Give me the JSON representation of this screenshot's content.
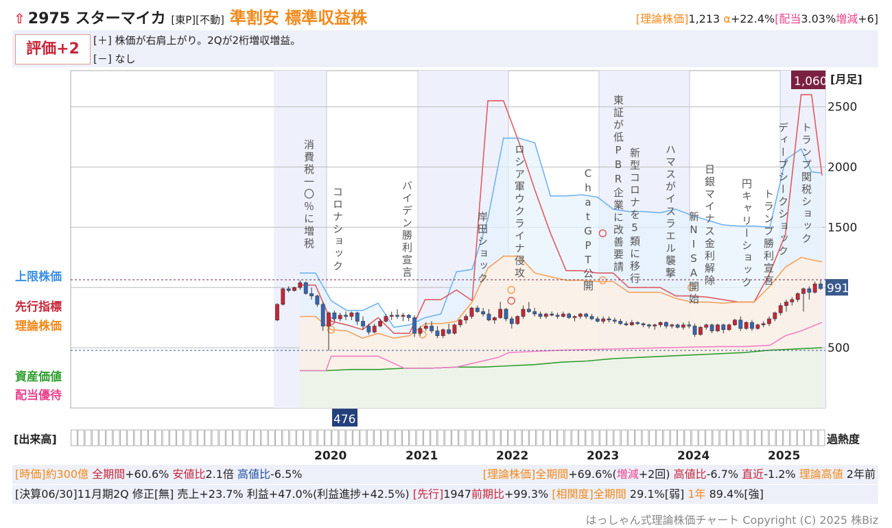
{
  "header": {
    "code": "2975",
    "name": "スターマイカ",
    "market": "[東P][不動]",
    "tags": "準割安 標準収益株",
    "theory_label": "[理論株価]",
    "theory_value": "1,213",
    "alpha_label": "α",
    "alpha_value": "+22.4%",
    "dividend_label": "[配当",
    "dividend_value": "3.03%",
    "change_label": "増減",
    "change_value": "+6]"
  },
  "evaluation": {
    "badge": "評価+2",
    "plus_line": "[＋] 株価が右肩上がり。2Qが2桁増収増益。",
    "minus_line": "[－] なし"
  },
  "side_labels": {
    "upper": "上限株価",
    "leading": "先行指標",
    "theory": "理論株価",
    "asset": "資産価値",
    "dividend": "配当優待"
  },
  "volume_label": "[出来高]",
  "heat_label": "過熱度",
  "footer": {
    "line1_left": [
      {
        "text": "[時価]約300億",
        "color": "#f08a1c"
      },
      {
        "text": " 全期間",
        "color": "#c6263a"
      },
      {
        "text": "+60.6% ",
        "color": "#222222"
      },
      {
        "text": "安値比",
        "color": "#c6263a"
      },
      {
        "text": "2.1倍 ",
        "color": "#222222"
      },
      {
        "text": "高値比",
        "color": "#1f4fa0"
      },
      {
        "text": "-6.5%",
        "color": "#222222"
      }
    ],
    "line1_right": [
      {
        "text": "[理論株価]全期間",
        "color": "#f08a1c"
      },
      {
        "text": "+69.6%(",
        "color": "#222222"
      },
      {
        "text": "増減",
        "color": "#e8458f"
      },
      {
        "text": "+2回) ",
        "color": "#222222"
      },
      {
        "text": "高値比",
        "color": "#c6263a"
      },
      {
        "text": "-6.7% ",
        "color": "#222222"
      },
      {
        "text": "直近",
        "color": "#c6263a"
      },
      {
        "text": "-1.2% ",
        "color": "#222222"
      },
      {
        "text": "理論高値",
        "color": "#f08a1c"
      },
      {
        "text": " 2年前",
        "color": "#222222"
      }
    ],
    "line2": [
      {
        "text": "[決算06/30]11月期2Q 修正[無] 売上+23.7% 利益+47.0%(利益進捗+42.5%) ",
        "color": "#222222"
      },
      {
        "text": "[先行]",
        "color": "#c6263a"
      },
      {
        "text": "1947",
        "color": "#222222"
      },
      {
        "text": "前期比",
        "color": "#c6263a"
      },
      {
        "text": "+99.3% ",
        "color": "#222222"
      },
      {
        "text": "[相関度]全期間",
        "color": "#f08a1c"
      },
      {
        "text": " 29.1%[弱] ",
        "color": "#222222"
      },
      {
        "text": "1年",
        "color": "#f08a1c"
      },
      {
        "text": " 89.4%[強]",
        "color": "#222222"
      }
    ],
    "copyright": "はっしゃん式理論株価チャート Copyright (C) 2025 株Biz"
  },
  "colors": {
    "candle_up": "#c6263a",
    "candle_down": "#3566b5",
    "upper_line": "#6fb2f0",
    "leading_line": "#e0595f",
    "theory_line": "#f5a05a",
    "asset_line": "#2e9e2e",
    "dividend_line": "#f07fc8",
    "event_text": "#555555"
  },
  "chart_data": {
    "type": "line",
    "unit_label": "[月足]",
    "y_ticks": [
      500,
      1000,
      1500,
      2000,
      2500
    ],
    "y_tick_labels": [
      "500",
      "",
      "1500",
      "2000",
      "2500"
    ],
    "ylim": [
      0,
      2800
    ],
    "x_tick_labels": [
      "2020",
      "2021",
      "2022",
      "2023",
      "2024",
      "2025"
    ],
    "current_price_label": "991",
    "high_label": "1,060",
    "low_label": "476",
    "events": [
      "消費税一〇％に増税",
      "コロナショック",
      "バイデン勝利宣言",
      "岸田ショック",
      "ロシア軍ウクライナ侵攻",
      "ChatGPT公開",
      "東証が低PBR企業に改善要請",
      "新型コロナを5類に移行",
      "ハマスがイスラエル襲撃",
      "新NISA開始",
      "日銀マイナス金利解除",
      "円キャリーショック",
      "トランプ勝利宣言",
      "ディープシークショック",
      "トランプ関税ショック"
    ],
    "candles": [
      [
        730,
        870,
        720,
        860
      ],
      [
        860,
        1000,
        850,
        990
      ],
      [
        990,
        1010,
        960,
        975
      ],
      [
        975,
        1010,
        965,
        1000
      ],
      [
        1000,
        1060,
        980,
        1040
      ],
      [
        1040,
        1050,
        940,
        950
      ],
      [
        950,
        1000,
        900,
        930
      ],
      [
        930,
        940,
        840,
        860
      ],
      [
        860,
        880,
        640,
        680
      ],
      [
        680,
        800,
        476,
        790
      ],
      [
        790,
        810,
        720,
        740
      ],
      [
        740,
        790,
        720,
        770
      ],
      [
        770,
        800,
        730,
        760
      ],
      [
        760,
        800,
        730,
        790
      ],
      [
        790,
        800,
        690,
        720
      ],
      [
        720,
        760,
        650,
        680
      ],
      [
        680,
        700,
        610,
        630
      ],
      [
        630,
        700,
        620,
        680
      ],
      [
        680,
        740,
        670,
        720
      ],
      [
        720,
        780,
        710,
        760
      ],
      [
        760,
        800,
        730,
        770
      ],
      [
        770,
        820,
        740,
        760
      ],
      [
        760,
        790,
        720,
        770
      ],
      [
        770,
        780,
        720,
        750
      ],
      [
        750,
        770,
        590,
        620
      ],
      [
        620,
        680,
        600,
        660
      ],
      [
        660,
        710,
        640,
        680
      ],
      [
        680,
        720,
        620,
        640
      ],
      [
        640,
        680,
        580,
        600
      ],
      [
        600,
        660,
        580,
        650
      ],
      [
        650,
        700,
        610,
        620
      ],
      [
        620,
        700,
        610,
        690
      ],
      [
        690,
        740,
        670,
        730
      ],
      [
        730,
        780,
        700,
        760
      ],
      [
        760,
        840,
        740,
        830
      ],
      [
        830,
        850,
        790,
        800
      ],
      [
        800,
        830,
        760,
        780
      ],
      [
        780,
        820,
        720,
        730
      ],
      [
        730,
        760,
        700,
        750
      ],
      [
        750,
        880,
        740,
        820
      ],
      [
        820,
        830,
        720,
        740
      ],
      [
        740,
        760,
        660,
        700
      ],
      [
        700,
        770,
        690,
        760
      ],
      [
        760,
        850,
        740,
        820
      ],
      [
        820,
        880,
        790,
        800
      ],
      [
        800,
        830,
        760,
        780
      ],
      [
        780,
        800,
        740,
        760
      ],
      [
        760,
        790,
        740,
        780
      ],
      [
        780,
        800,
        760,
        770
      ],
      [
        770,
        790,
        740,
        760
      ],
      [
        760,
        800,
        750,
        780
      ],
      [
        780,
        790,
        740,
        750
      ],
      [
        750,
        770,
        720,
        760
      ],
      [
        760,
        790,
        740,
        780
      ],
      [
        780,
        790,
        740,
        760
      ],
      [
        760,
        780,
        730,
        740
      ],
      [
        740,
        760,
        710,
        720
      ],
      [
        720,
        760,
        700,
        740
      ],
      [
        740,
        760,
        710,
        730
      ],
      [
        730,
        750,
        700,
        720
      ],
      [
        720,
        740,
        690,
        700
      ],
      [
        700,
        720,
        680,
        690
      ],
      [
        690,
        730,
        680,
        710
      ],
      [
        710,
        720,
        690,
        700
      ],
      [
        700,
        710,
        670,
        690
      ],
      [
        690,
        700,
        660,
        680
      ],
      [
        680,
        700,
        650,
        690
      ],
      [
        690,
        720,
        670,
        710
      ],
      [
        710,
        720,
        660,
        680
      ],
      [
        680,
        700,
        660,
        690
      ],
      [
        690,
        700,
        660,
        670
      ],
      [
        670,
        710,
        650,
        690
      ],
      [
        690,
        720,
        660,
        680
      ],
      [
        680,
        700,
        590,
        610
      ],
      [
        610,
        680,
        600,
        670
      ],
      [
        670,
        700,
        650,
        690
      ],
      [
        690,
        700,
        620,
        640
      ],
      [
        640,
        700,
        630,
        690
      ],
      [
        690,
        700,
        620,
        650
      ],
      [
        650,
        700,
        640,
        690
      ],
      [
        690,
        740,
        680,
        730
      ],
      [
        730,
        760,
        640,
        660
      ],
      [
        660,
        720,
        650,
        710
      ],
      [
        710,
        730,
        640,
        660
      ],
      [
        660,
        700,
        650,
        690
      ],
      [
        690,
        720,
        670,
        700
      ],
      [
        700,
        760,
        680,
        740
      ],
      [
        740,
        800,
        720,
        790
      ],
      [
        790,
        870,
        770,
        850
      ],
      [
        850,
        900,
        800,
        880
      ],
      [
        880,
        920,
        850,
        900
      ],
      [
        900,
        960,
        880,
        950
      ],
      [
        950,
        1000,
        800,
        990
      ],
      [
        990,
        1010,
        900,
        960
      ],
      [
        960,
        1050,
        950,
        1030
      ],
      [
        1030,
        1060,
        980,
        991
      ]
    ],
    "series": [
      {
        "name": "上限株価",
        "x": [
          0.0,
          0.03,
          0.06,
          0.09,
          0.12,
          0.15,
          0.18,
          0.21,
          0.24,
          0.27,
          0.3,
          0.33,
          0.36,
          0.39,
          0.42,
          0.45,
          0.48,
          0.51,
          0.54,
          0.57,
          0.6,
          0.63,
          0.66,
          0.69,
          0.72,
          0.75,
          0.78,
          0.81,
          0.84,
          0.87,
          0.9,
          0.93,
          0.96,
          0.98,
          1.0
        ],
        "values": [
          1120,
          1120,
          890,
          810,
          810,
          870,
          670,
          690,
          750,
          780,
          1130,
          1150,
          1570,
          2240,
          2240,
          2200,
          1760,
          1760,
          1770,
          1750,
          1650,
          1630,
          1630,
          1620,
          1650,
          1600,
          1560,
          1520,
          1510,
          1510,
          1500,
          2060,
          2150,
          1960,
          1950
        ]
      },
      {
        "name": "先行指標",
        "x": [
          0.0,
          0.03,
          0.06,
          0.09,
          0.12,
          0.15,
          0.18,
          0.21,
          0.24,
          0.27,
          0.3,
          0.33,
          0.36,
          0.39,
          0.42,
          0.45,
          0.48,
          0.51,
          0.54,
          0.57,
          0.6,
          0.63,
          0.66,
          0.69,
          0.72,
          0.75,
          0.78,
          0.81,
          0.84,
          0.87,
          0.9,
          0.93,
          0.96,
          0.98,
          1.0
        ],
        "values": [
          1020,
          1020,
          720,
          690,
          650,
          750,
          620,
          620,
          900,
          900,
          980,
          890,
          2550,
          2550,
          2200,
          1810,
          1450,
          1140,
          1140,
          1120,
          1120,
          1000,
          1000,
          1000,
          930,
          930,
          920,
          900,
          880,
          880,
          1120,
          1440,
          2600,
          2600,
          1930
        ]
      },
      {
        "name": "理論株価",
        "x": [
          0.0,
          0.03,
          0.06,
          0.09,
          0.12,
          0.15,
          0.18,
          0.21,
          0.24,
          0.27,
          0.3,
          0.33,
          0.36,
          0.39,
          0.42,
          0.45,
          0.48,
          0.51,
          0.54,
          0.57,
          0.6,
          0.63,
          0.66,
          0.69,
          0.72,
          0.75,
          0.78,
          0.81,
          0.84,
          0.87,
          0.9,
          0.93,
          0.96,
          0.98,
          1.0
        ],
        "values": [
          760,
          760,
          650,
          640,
          580,
          620,
          580,
          600,
          700,
          700,
          720,
          880,
          1160,
          1260,
          1260,
          1120,
          1090,
          1060,
          1060,
          1050,
          1050,
          960,
          960,
          960,
          910,
          880,
          880,
          870,
          880,
          880,
          1010,
          1170,
          1250,
          1230,
          1213
        ]
      },
      {
        "name": "資産価値",
        "x": [
          0.0,
          0.05,
          0.1,
          0.15,
          0.2,
          0.25,
          0.3,
          0.35,
          0.4,
          0.45,
          0.5,
          0.55,
          0.6,
          0.65,
          0.7,
          0.75,
          0.8,
          0.85,
          0.9,
          0.95,
          1.0
        ],
        "values": [
          310,
          310,
          320,
          320,
          330,
          330,
          340,
          340,
          350,
          360,
          380,
          390,
          410,
          420,
          430,
          440,
          450,
          460,
          480,
          490,
          500
        ]
      },
      {
        "name": "配当優待",
        "x": [
          0.0,
          0.05,
          0.06,
          0.15,
          0.2,
          0.25,
          0.3,
          0.38,
          0.4,
          0.5,
          0.6,
          0.7,
          0.8,
          0.85,
          0.9,
          0.93,
          0.96,
          1.0
        ],
        "values": [
          310,
          310,
          430,
          430,
          330,
          330,
          340,
          420,
          460,
          480,
          490,
          500,
          510,
          510,
          520,
          600,
          640,
          710
        ]
      }
    ]
  }
}
